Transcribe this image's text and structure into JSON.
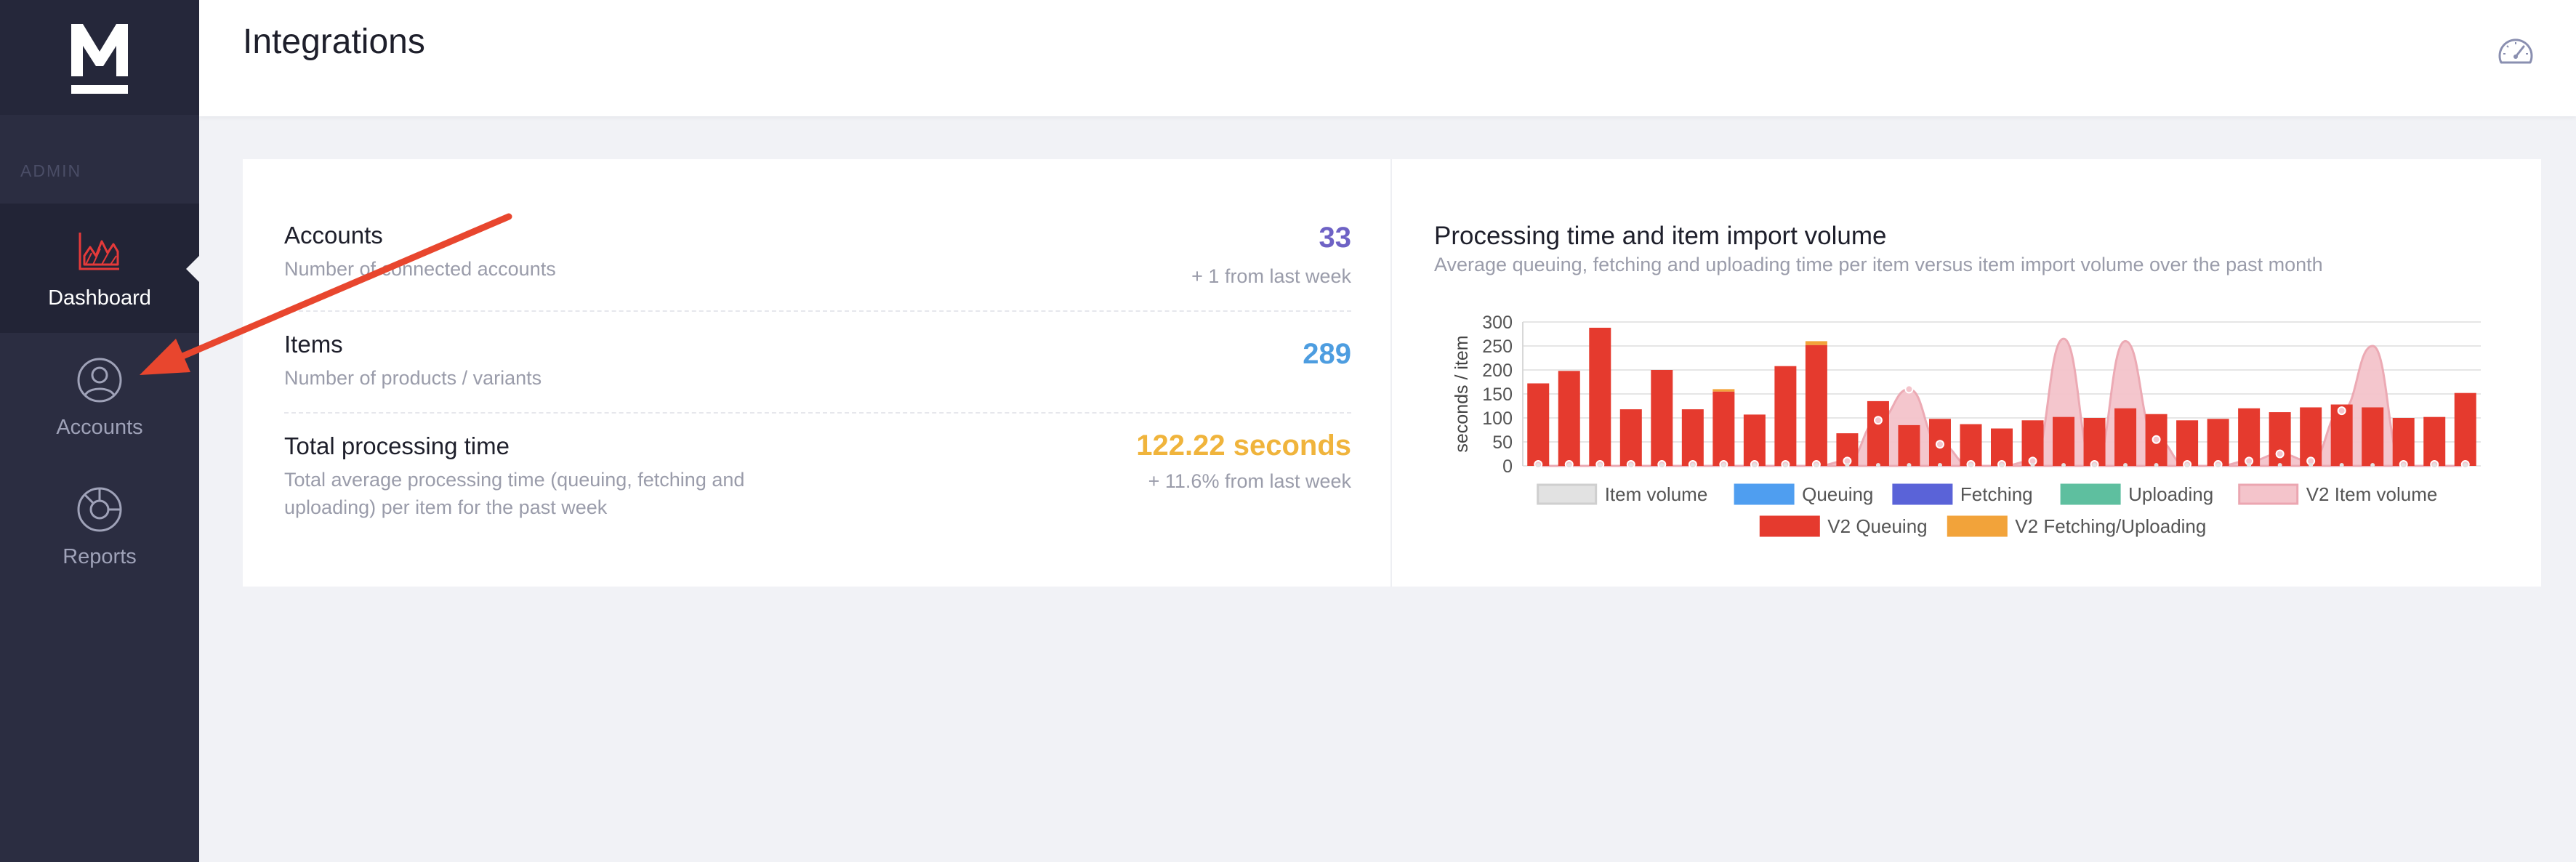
{
  "sidebar": {
    "logo_letter": "M",
    "section_label": "ADMIN",
    "items": [
      {
        "label": "Dashboard",
        "icon": "chart-icon",
        "active": true
      },
      {
        "label": "Accounts",
        "icon": "user-icon",
        "active": false
      },
      {
        "label": "Reports",
        "icon": "reports-icon",
        "active": false
      }
    ]
  },
  "header": {
    "title": "Integrations",
    "action_icon": "gauge-icon"
  },
  "stats": [
    {
      "title": "Accounts",
      "subtitle": "Number of connected accounts",
      "value": "33",
      "change": "+ 1 from last week",
      "color": "#6e62c5"
    },
    {
      "title": "Items",
      "subtitle": "Number of products / variants",
      "value": "289",
      "change": "",
      "color": "#4d9de0"
    },
    {
      "title": "Total processing time",
      "subtitle": "Total average processing time (queuing, fetching and uploading) per item for the past week",
      "value": "122.22 seconds",
      "change": "+ 11.6% from last week",
      "color": "#f0b43c"
    }
  ],
  "colors": {
    "sidebar_bg": "#2b2d41",
    "accent_red": "#e53a2e",
    "annotation_arrow": "#e8462e"
  },
  "chart": {
    "title": "Processing time and item import volume",
    "subtitle": "Average queuing, fetching and uploading time per item versus item import volume over the past month"
  },
  "chart_data": {
    "type": "bar",
    "ylabel": "seconds / item",
    "ylim": [
      0,
      300
    ],
    "yticks": [
      0,
      50,
      100,
      150,
      200,
      250,
      300
    ],
    "grid": true,
    "legend_position": "bottom",
    "legend": [
      {
        "name": "Item volume",
        "color": "#e2e2e2",
        "border": "#cfcfcf"
      },
      {
        "name": "Queuing",
        "color": "#4f9ef0",
        "border": "#4f9ef0"
      },
      {
        "name": "Fetching",
        "color": "#5a63d8",
        "border": "#5a63d8"
      },
      {
        "name": "Uploading",
        "color": "#5ebf9f",
        "border": "#5ebf9f"
      },
      {
        "name": "V2 Item volume",
        "color": "#f4c4cb",
        "border": "#eba6b1"
      },
      {
        "name": "V2 Queuing",
        "color": "#e53a2e",
        "border": "#e53a2e"
      },
      {
        "name": "V2 Fetching/Uploading",
        "color": "#f2a33a",
        "border": "#f2a33a"
      }
    ],
    "series": [
      {
        "name": "V2 Queuing",
        "values": [
          172,
          198,
          288,
          118,
          200,
          118,
          155,
          107,
          208,
          252,
          68,
          135,
          85,
          98,
          87,
          78,
          95,
          102,
          100,
          120,
          108,
          95,
          98,
          120,
          112,
          122,
          128,
          122,
          100,
          102,
          152
        ]
      },
      {
        "name": "V2 Fetching/Uploading",
        "values": [
          0,
          0,
          0,
          0,
          0,
          0,
          5,
          0,
          0,
          8,
          0,
          0,
          0,
          0,
          0,
          0,
          0,
          0,
          0,
          0,
          0,
          0,
          0,
          0,
          0,
          0,
          0,
          0,
          0,
          0,
          0
        ]
      },
      {
        "name": "V2 Item volume",
        "values": [
          0,
          0,
          0,
          0,
          0,
          0,
          0,
          0,
          0,
          0,
          10,
          95,
          160,
          45,
          0,
          0,
          10,
          265,
          0,
          260,
          55,
          0,
          0,
          10,
          25,
          10,
          115,
          250,
          0,
          0,
          0
        ]
      },
      {
        "name": "Item volume",
        "values": [
          0,
          0,
          0,
          0,
          0,
          0,
          0,
          0,
          0,
          0,
          0,
          0,
          0,
          0,
          0,
          0,
          0,
          0,
          0,
          0,
          0,
          0,
          0,
          0,
          0,
          0,
          0,
          0,
          0,
          0,
          0
        ]
      }
    ]
  }
}
